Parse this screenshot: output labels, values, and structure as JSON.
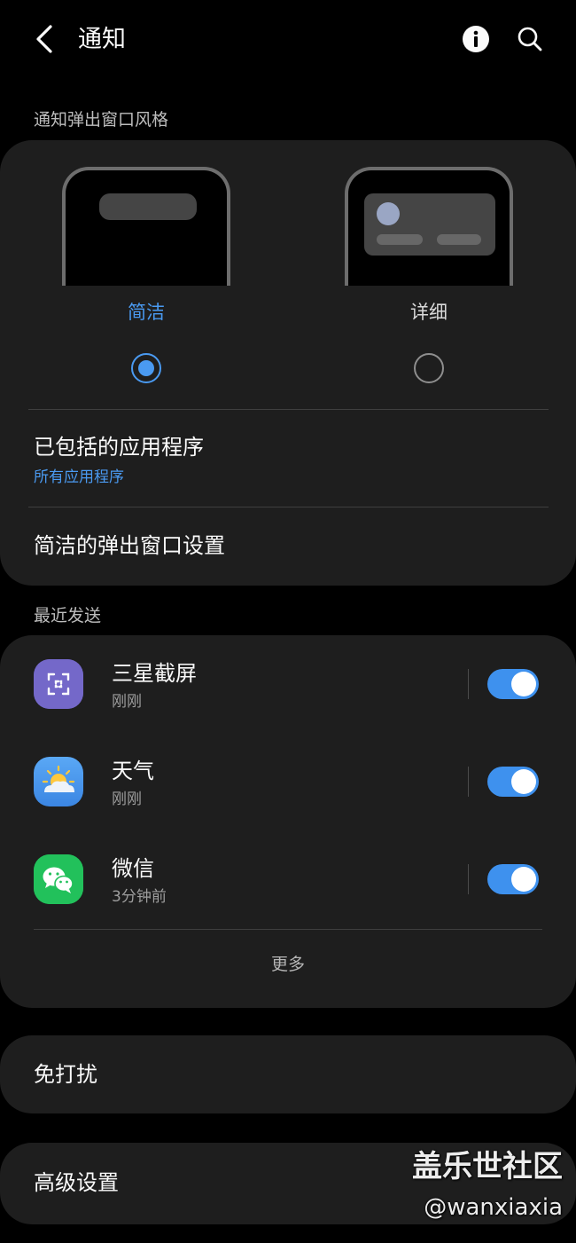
{
  "header": {
    "title": "通知",
    "back_icon": "chevron-left-icon",
    "info_icon": "info-icon",
    "search_icon": "search-icon"
  },
  "popup_style": {
    "section_label": "通知弹出窗口风格",
    "options": [
      {
        "label": "简洁",
        "selected": true
      },
      {
        "label": "详细",
        "selected": false
      }
    ],
    "accent_color": "#4a9af1"
  },
  "included_apps": {
    "title": "已包括的应用程序",
    "value": "所有应用程序"
  },
  "brief_popup_settings": {
    "title": "简洁的弹出窗口设置"
  },
  "recent": {
    "section_label": "最近发送",
    "apps": [
      {
        "name": "三星截屏",
        "time": "刚刚",
        "icon": "screenshot-icon",
        "enabled": true
      },
      {
        "name": "天气",
        "time": "刚刚",
        "icon": "weather-icon",
        "enabled": true
      },
      {
        "name": "微信",
        "time": "3分钟前",
        "icon": "wechat-icon",
        "enabled": true
      }
    ],
    "more_label": "更多"
  },
  "do_not_disturb": {
    "title": "免打扰"
  },
  "advanced": {
    "title": "高级设置"
  },
  "watermark": {
    "line1": "盖乐世社区",
    "line2": "@wanxiaxia"
  }
}
